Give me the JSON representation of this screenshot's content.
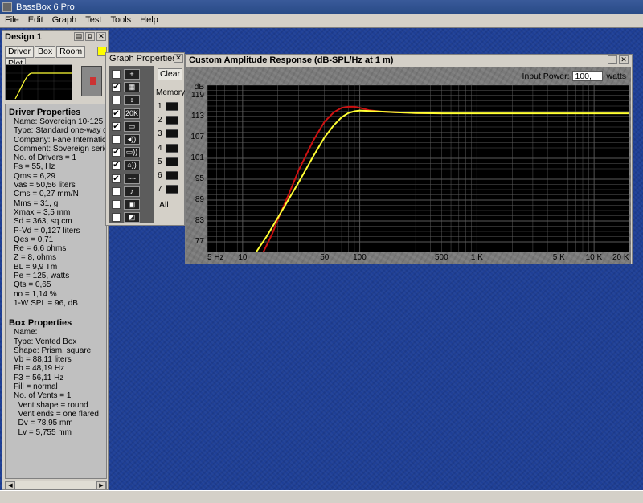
{
  "app": {
    "title": "BassBox 6 Pro"
  },
  "menu": [
    "File",
    "Edit",
    "Graph",
    "Test",
    "Tools",
    "Help"
  ],
  "design": {
    "title": "Design 1",
    "tabs": [
      "Driver",
      "Box",
      "Room",
      "Plot"
    ],
    "driver_header": "Driver Properties",
    "driver_lines": [
      "Name: Sovereign 10-125",
      "Type: Standard one-way driv",
      "Company: Fane Internationa",
      "Comment: Sovereign series",
      "No. of Drivers = 1",
      "Fs = 55, Hz",
      "Qms = 6,29",
      "Vas = 50,56 liters",
      "Cms = 0,27 mm/N",
      "Mms = 31, g",
      "Xmax = 3,5 mm",
      "Sd = 363, sq.cm",
      "P-Vd = 0,127 liters",
      "Qes = 0,71",
      "Re = 6,6 ohms",
      "Z = 8, ohms",
      "BL = 9,9 Tm",
      "Pe = 125, watts",
      "Qts = 0,65",
      "no = 1,14 %",
      "1-W SPL = 96, dB"
    ],
    "box_header": "Box Properties",
    "box_lines": [
      "Name:",
      "Type: Vented Box",
      "Shape: Prism, square",
      "Vb = 88,11 liters",
      "Fb = 48,19 Hz",
      "F3 = 56,11 Hz",
      "Fill = normal",
      "No. of Vents = 1",
      "  Vent shape = round",
      "  Vent ends = one flared",
      "  Dv = 78,95 mm",
      "  Lv = 5,755 mm"
    ]
  },
  "graph_props": {
    "title": "Graph Properties",
    "clear_label": "Clear",
    "memory_label": "Memory",
    "memory_slots": [
      "1",
      "2",
      "3",
      "4",
      "5",
      "6",
      "7"
    ],
    "all_label": "All",
    "checked": [
      false,
      true,
      false,
      true,
      true,
      false,
      true,
      true,
      true,
      false,
      false,
      false
    ],
    "icon_text": [
      "+",
      "▦",
      "↕",
      "20K",
      "▭",
      "◂))",
      "▭))",
      "⌂))",
      "~~",
      "♪",
      "▣",
      "◩"
    ]
  },
  "graph": {
    "title": "Custom Amplitude Response (dB-SPL/Hz at 1 m)",
    "input_power_label": "Input Power:",
    "input_power_value": "100,",
    "input_power_unit": "watts",
    "y_unit": "dB",
    "colors": {
      "plot_bg": "#000000",
      "grid": "#5a5a5a",
      "curve_current": "#ffff33",
      "curve_memory": "#cc1111"
    }
  },
  "chart_data": {
    "type": "line",
    "xscale": "log",
    "xlim": [
      5,
      20000
    ],
    "ylim": [
      74,
      122
    ],
    "x_ticks": [
      5,
      10,
      50,
      100,
      500,
      1000,
      5000,
      10000,
      20000
    ],
    "x_tick_labels": [
      "5 Hz",
      "10",
      "50",
      "100",
      "500",
      "1 K",
      "5 K",
      "10 K",
      "20 K"
    ],
    "y_ticks": [
      77,
      83,
      89,
      95,
      101,
      107,
      113,
      119
    ],
    "y_tick_labels": [
      "77",
      "83",
      "89",
      "95",
      "101",
      "107",
      "113",
      "119"
    ],
    "ylabel": "dB",
    "series": [
      {
        "color": "#ffff33",
        "x": [
          13,
          16,
          20,
          25,
          30,
          40,
          50,
          60,
          70,
          80,
          90,
          100,
          150,
          200,
          300,
          500,
          1000,
          20000
        ],
        "y": [
          74,
          78.5,
          84,
          89.5,
          94,
          101.5,
          107,
          110.5,
          112.8,
          114,
          114.5,
          114.7,
          114.4,
          114.2,
          114,
          113.9,
          113.9,
          113.9
        ]
      },
      {
        "color": "#cc1111",
        "x": [
          15,
          18,
          20,
          25,
          30,
          40,
          50,
          60,
          70,
          80,
          90,
          100,
          120,
          150,
          200,
          300,
          500
        ],
        "y": [
          74,
          79.5,
          83.5,
          91,
          97.5,
          106,
          111.5,
          114.2,
          115.5,
          115.8,
          115.8,
          115.5,
          114.8,
          114.4,
          114.2,
          114,
          113.9
        ]
      }
    ]
  }
}
